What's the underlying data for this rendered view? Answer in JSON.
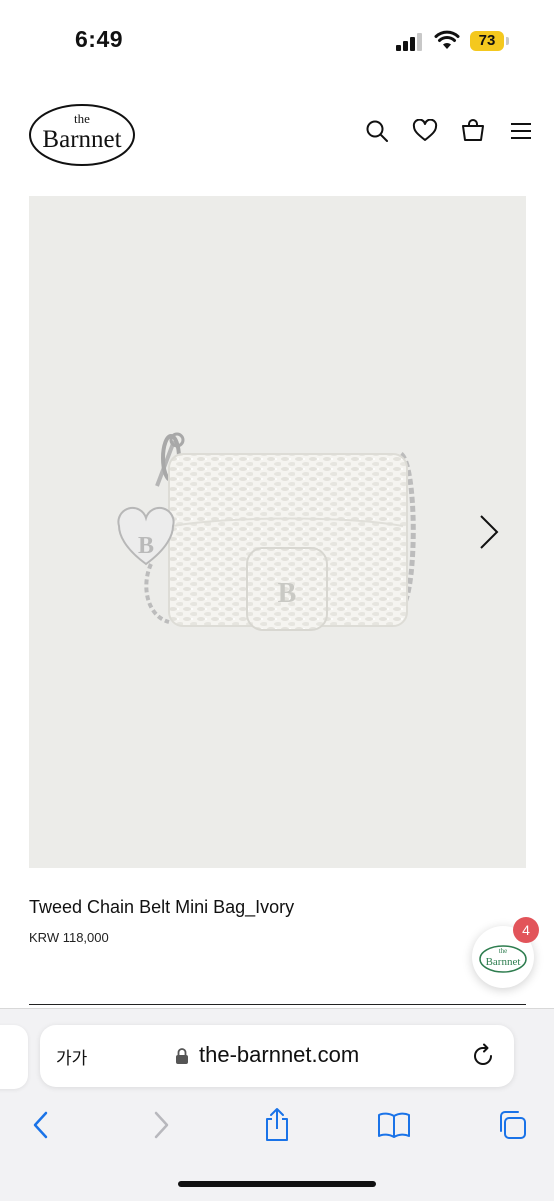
{
  "status_bar": {
    "time": "6:49",
    "battery_level": "73",
    "battery_color": "#f4c81e"
  },
  "header": {
    "logo_top": "the",
    "logo_main": "Barnnet",
    "icons": [
      "search-icon",
      "heart-icon",
      "bag-icon",
      "menu-icon"
    ]
  },
  "product": {
    "title": "Tweed Chain Belt Mini Bag_Ivory",
    "price": "KRW 118,000",
    "image_background": "#ecece9"
  },
  "floating_widget": {
    "logo_top": "the",
    "logo_main": "Barnnet",
    "notification_count": "4",
    "notification_color": "#e2545a"
  },
  "browser": {
    "text_size_label": "가가",
    "url": "the-barnnet.com",
    "accent_color": "#1a73e8",
    "toolbar_icons": [
      "back-icon",
      "forward-icon",
      "share-icon",
      "bookmarks-icon",
      "tabs-icon"
    ]
  }
}
